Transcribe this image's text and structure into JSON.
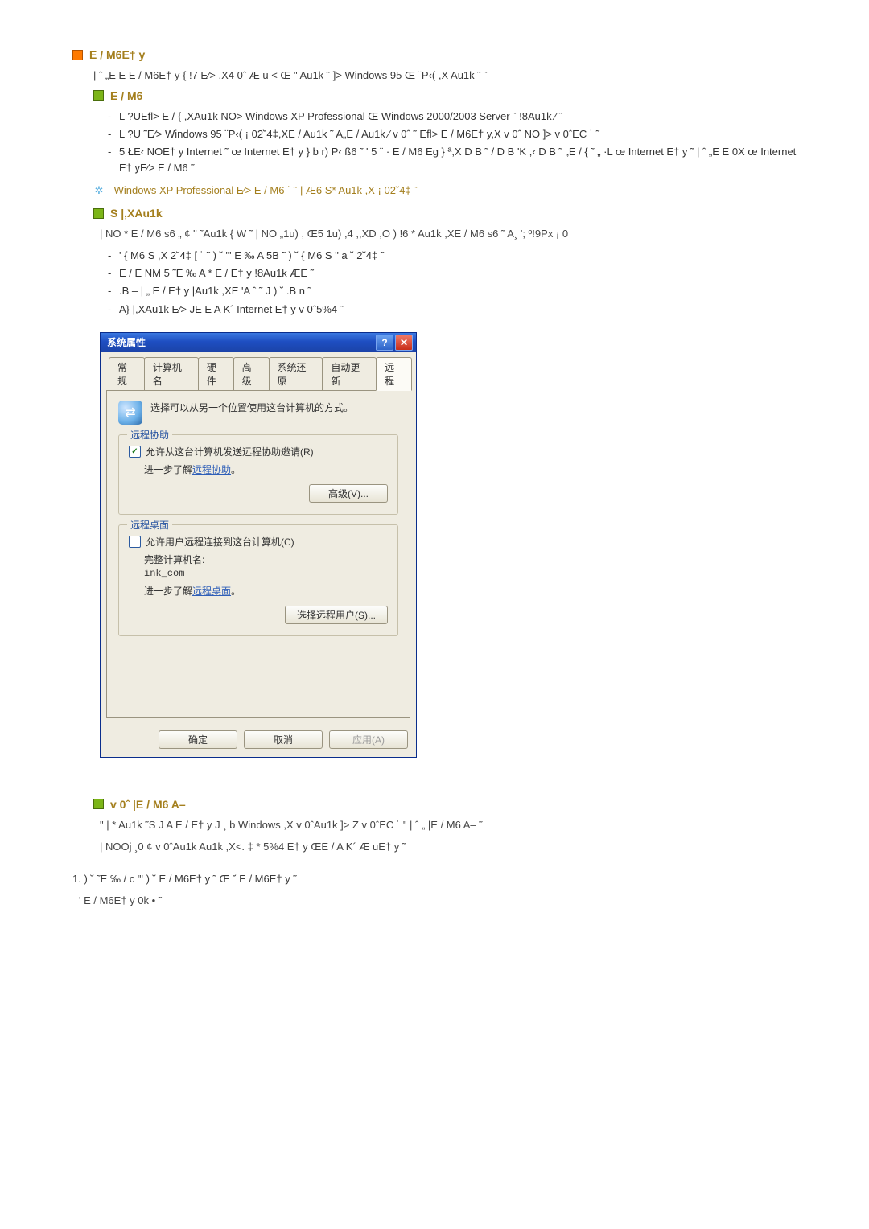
{
  "doc": {
    "h1": "E /   M6E† y",
    "intro": "| ˆ „E E E /   M6E† y { !7  E⁄>             ,X4 0ˆ Æ u < Œ \"    Au1k   ˜ ]>          Windows 95  Œ ¨P‹(   ,X Au1k   ˜ ˜",
    "h2_em6": "E /   M6",
    "em6_list": [
      "L ?UEfl> E / {  ,XAu1k   NO>          Windows XP Professional  Œ Windows 2000/2003 Server ˜  !8Au1k  ⁄          ˜",
      "L ?U  ˜E⁄>      Windows 95  ¨P‹(    ¡ 02˘4‡,XE / Au1k  ˜  A„E / Au1k ⁄     v 0ˆ  ˜  Efl> E /   M6E† y,X v  0ˆ  NO ]>     v  0ˆEC ˙ ˜",
      "5  ŁE‹  NOE† y      Internet ˜    œ   Internet E† y   } b r)  P‹ ß6  ˜  ' 5  ¨ ·  E /   M6  Eg    }  ª,X D B ˜     /  D B 'K ,‹              D B ˜ „E / {     ˜   „ ·L   œ               Internet E† y ˜   | ˆ „E  E 0X œ     Internet E† yE⁄> E /   M6 ˜"
    ],
    "snowline": "Windows XP Professional   E⁄> E /   M6 ˙ ˜  |              Æ6  S* Au1k  ,X ¡ 02˘4‡ ˜",
    "h2_sx": "S |,XAu1k",
    "sx_p1": "| NO  * E /   M6 s6  „ ¢ \"  ˜Au1k  {  W ˜   |  NO „1u)  , Œ5 1u)  ,4    ,,XD  ,O ) !6   * Au1k   ,XE /   M6 s6  ˜  A¸  ';   º!9Px ¡ 0",
    "sx_list": [
      "'    {  M6 S   ,X  2˘4‡  [ ˙  ˜  ) ˘       \"'   E  ‰   A 5B  ˜ ) ˘  {  M6 S   \" a   ˘  2˘4‡      ˜",
      "   E /   E NM 5  ˜E  ‰    A *   E / E† y  !8Au1k    ÆE   ˜",
      ".B – | „  E / E† y   |Au1k  ,XE  'A  ˆ ˜ J ) ˘  .B n  ˜",
      "A} |,XAu1k  E⁄>  JE E A K´     Internet E† y   v  0ˆ5%4  ˜"
    ],
    "h2_v0": "v 0ˆ   |E /   M6 A–",
    "v0_p1": " \" | *    Au1k  ˜S J  A E / E† y J   ¸ b                  Windows ,X v  0ˆAu1k    ]>  Z v  0ˆEC  ˙ \"   | ˆ „  |E /   M6  A– ˜",
    "v0_p2": "|  NOOj  ¸0  ¢ v  0ˆAu1k      Au1k  ,X<. ‡  * 5%4 E† y ŒE / A K´ Æ  uE† y ˜",
    "numstep": "1.    ) ˘       ˜E  ‰     /  c   \"'   ) ˘ E /   M6E† y  ˜   Œ   ˘ E /   M6E† y     ˜",
    "numstep_sub": "'    E /   M6E† y  0k • ˜"
  },
  "dialog": {
    "title": "系统属性",
    "tabs": [
      "常规",
      "计算机名",
      "硬件",
      "高级",
      "系统还原",
      "自动更新",
      "远程"
    ],
    "active_tab_index": 6,
    "info_text": "选择可以从另一个位置使用这台计算机的方式。",
    "group_assist": {
      "legend": "远程协助",
      "chk_label": "允许从这台计算机发送远程协助邀请(R)",
      "learn_prefix": "进一步了解",
      "learn_link": "远程协助",
      "learn_suffix": "。",
      "btn_adv": "高级(V)..."
    },
    "group_desktop": {
      "legend": "远程桌面",
      "chk_label": "允许用户远程连接到这台计算机(C)",
      "full_name_label": "完整计算机名:",
      "full_name_value": "ink_com",
      "learn_prefix": "进一步了解",
      "learn_link": "远程桌面",
      "learn_suffix": "。",
      "btn_select": "选择远程用户(S)..."
    },
    "footer": {
      "ok": "确定",
      "cancel": "取消",
      "apply": "应用(A)"
    }
  }
}
